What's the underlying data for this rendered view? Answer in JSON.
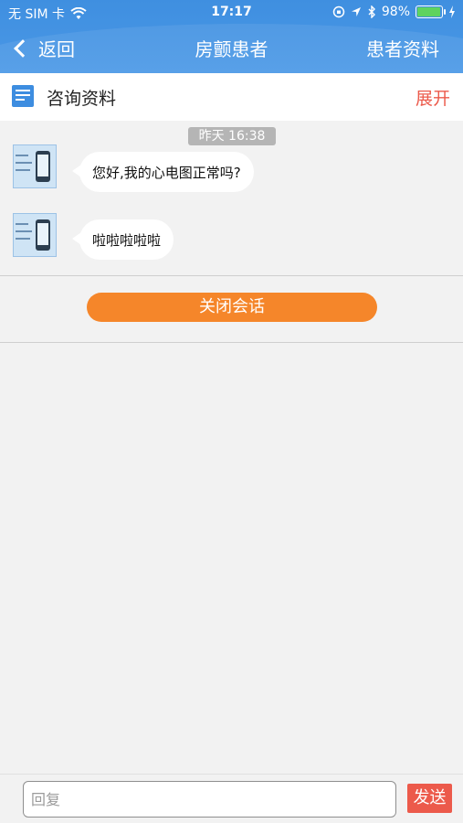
{
  "status_bar": {
    "carrier": "无 SIM 卡",
    "time": "17:17",
    "battery": "98%",
    "icons": [
      "wifi-icon",
      "lock-rotation-icon",
      "location-icon",
      "bluetooth-icon",
      "battery-icon",
      "charging-icon"
    ],
    "battery_level": 0.98
  },
  "navbar": {
    "back_label": "返回",
    "title": "房颤患者",
    "right_label": "患者资料"
  },
  "info_row": {
    "title": "咨询资料",
    "action": "展开"
  },
  "chat": {
    "timestamp": "昨天 16:38",
    "messages": [
      {
        "text": "您好,我的心电图正常吗?"
      },
      {
        "text": "啦啦啦啦啦"
      }
    ]
  },
  "actions": {
    "close_session": "关闭会话"
  },
  "input_bar": {
    "placeholder": "回复",
    "send_label": "发送"
  },
  "colors": {
    "header_blue": "#4a98e6",
    "accent_orange": "#f5862a",
    "accent_red": "#ec5a4b"
  }
}
